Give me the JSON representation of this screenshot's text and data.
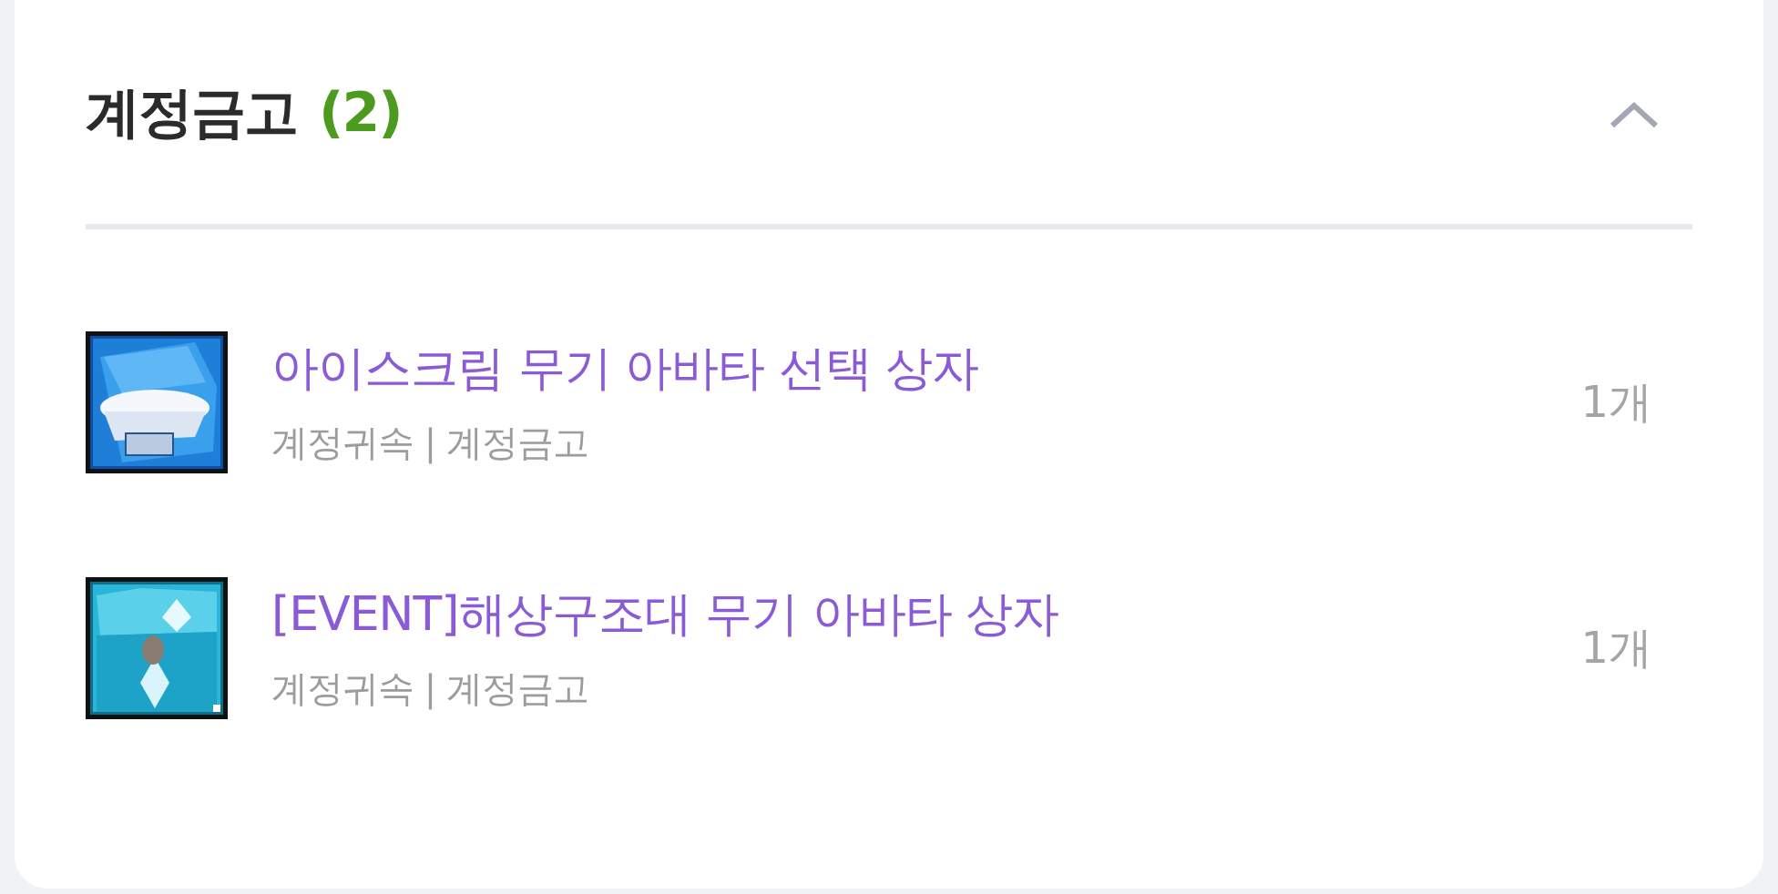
{
  "section": {
    "title": "계정금고",
    "count": "(2)",
    "expanded": true
  },
  "items": [
    {
      "kind": "box",
      "name": "아이스크림 무기 아바타 선택 상자",
      "meta": "계정귀속 | 계정금고",
      "quantity": "1개"
    },
    {
      "kind": "chest",
      "name": "[EVENT]해상구조대 무기 아바타 상자",
      "meta": "계정귀속 | 계정금고",
      "quantity": "1개"
    }
  ]
}
